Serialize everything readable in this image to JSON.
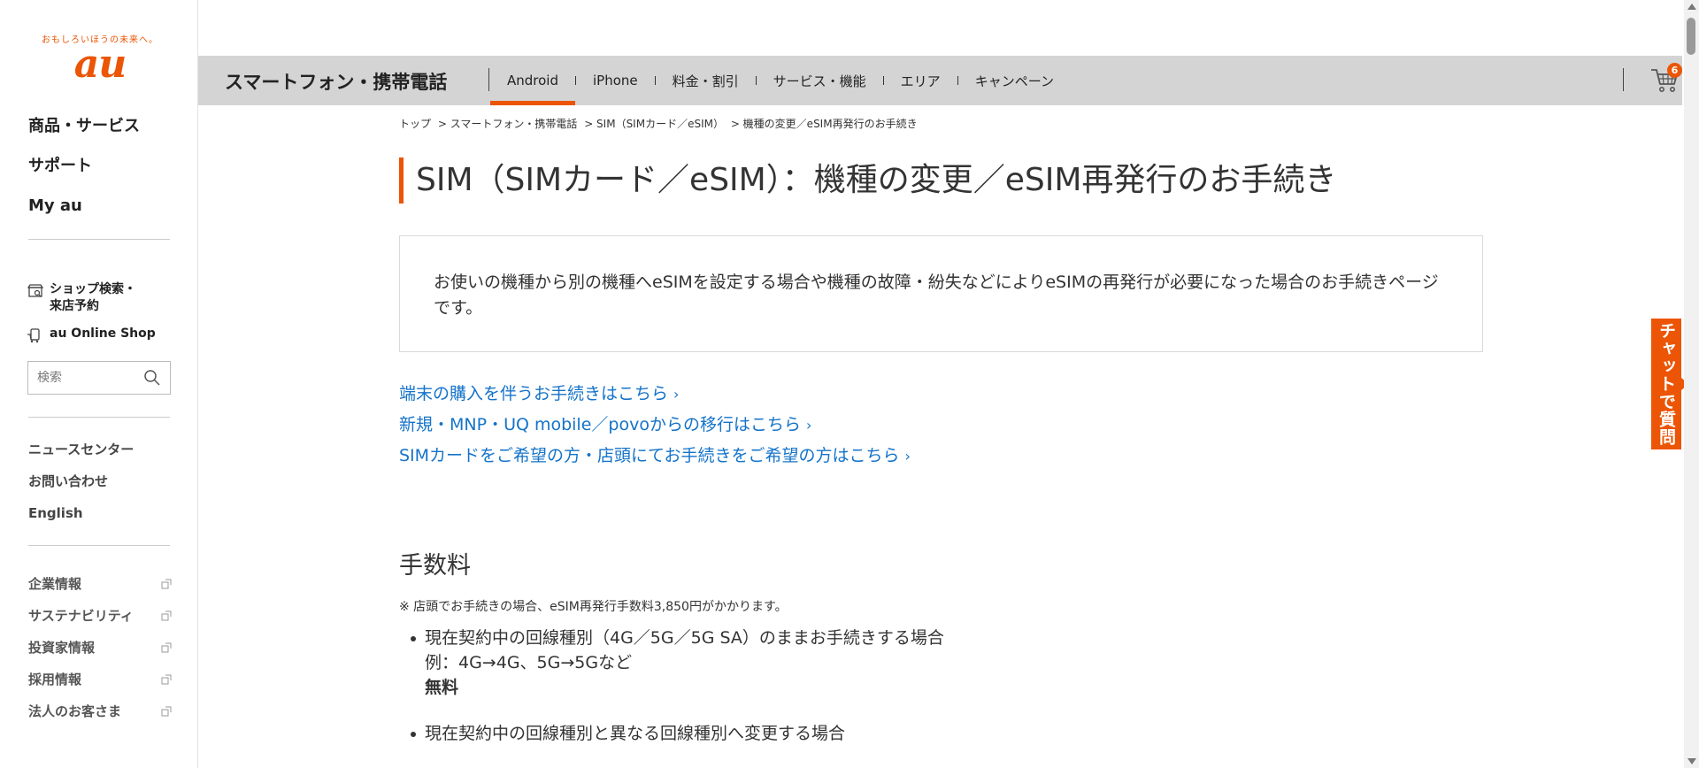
{
  "brand": {
    "tagline": "おもしろいほうの未来へ。",
    "logo_text": "au",
    "accent_color": "#eb5505",
    "link_color": "#1473c9"
  },
  "sidebar": {
    "primary_nav": [
      "商品・サービス",
      "サポート",
      "My au"
    ],
    "shop_links": [
      {
        "label": "ショップ検索・来店予約",
        "icon": "shop-search-icon"
      },
      {
        "label": "au Online Shop",
        "icon": "online-shop-icon"
      }
    ],
    "search": {
      "placeholder": "検索",
      "icon": "search-icon"
    },
    "sub_nav": [
      "ニュースセンター",
      "お問い合わせ",
      "English"
    ],
    "corp_nav": [
      "企業情報",
      "サステナビリティ",
      "投資家情報",
      "採用情報",
      "法人のお客さま"
    ]
  },
  "header": {
    "title": "スマートフォン・携帯電話",
    "tabs": [
      "Android",
      "iPhone",
      "料金・割引",
      "サービス・機能",
      "エリア",
      "キャンペーン"
    ],
    "active_tab": "Android",
    "cart": {
      "icon": "cart-icon",
      "count": "6"
    }
  },
  "breadcrumb": [
    "トップ",
    "> スマートフォン・携帯電話",
    "> SIM（SIMカード／eSIM）",
    "> 機種の変更／eSIM再発行のお手続き"
  ],
  "main": {
    "title": "SIM（SIMカード／eSIM）：機種の変更／eSIM再発行のお手続き",
    "intro": "お使いの機種から別の機種へeSIMを設定する場合や機種の故障・紛失などによりeSIMの再発行が必要になった場合のお手続きページです。",
    "links": [
      "端末の購入を伴うお手続きはこちら",
      "新規・MNP・UQ mobile／povoからの移行はこちら",
      "SIMカードをご希望の方・店頭にてお手続きをご希望の方はこちら"
    ],
    "section_title": "手数料",
    "note": "※  店頭でお手続きの場合、eSIM再発行手数料3,850円がかかります。",
    "bullets": [
      {
        "line1": "現在契約中の回線種別（4G／5G／5G SA）のままお手続きする場合",
        "line2": "例：4G→4G、5G→5Gなど",
        "line3": "無料"
      },
      {
        "line1": "現在契約中の回線種別と異なる回線種別へ変更する場合"
      }
    ]
  },
  "chat_tab": "チャットで質問"
}
